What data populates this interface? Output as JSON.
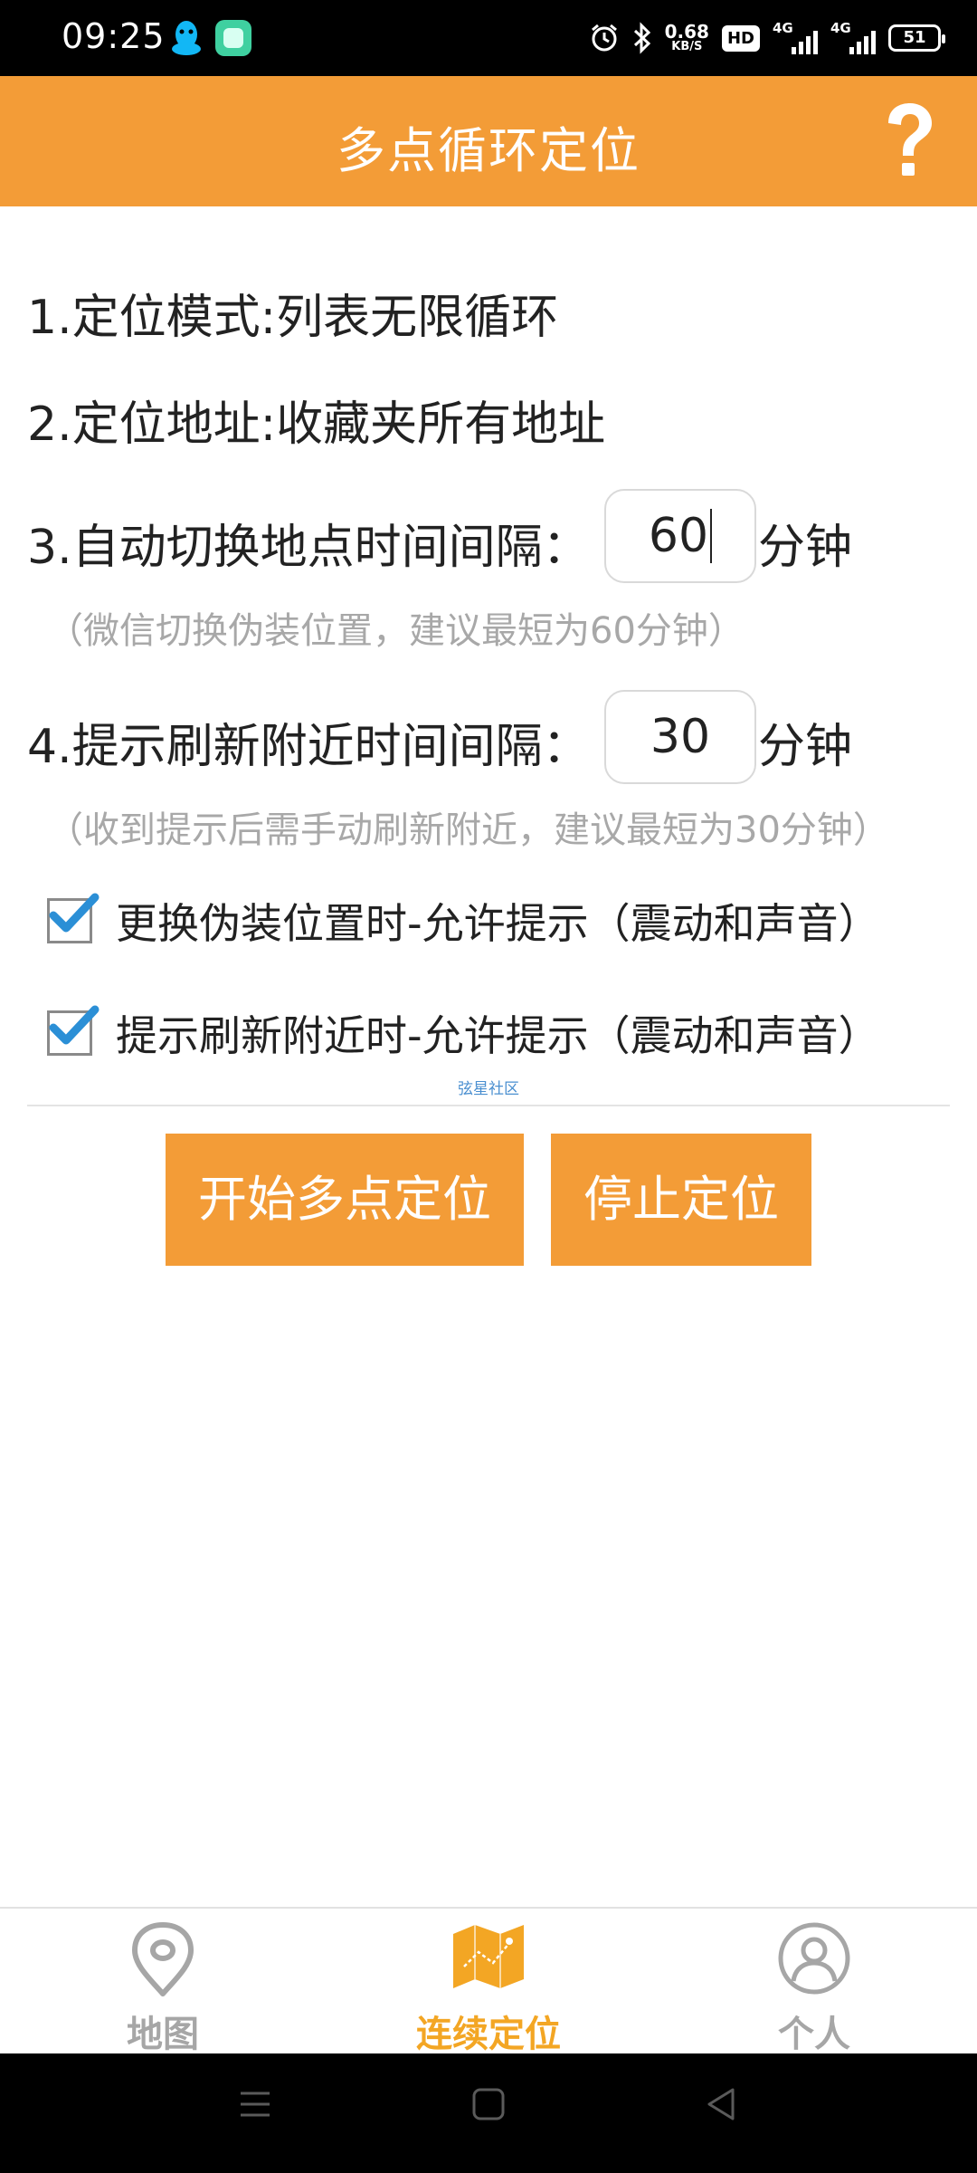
{
  "status_bar": {
    "time": "09:25",
    "net_speed_value": "0.68",
    "net_speed_unit": "KB/S",
    "hd_label": "HD",
    "sim1_label": "4G",
    "sim2_label": "4G",
    "battery": "51"
  },
  "header": {
    "title": "多点循环定位",
    "help_icon": "question-mark-icon"
  },
  "settings": {
    "mode_line": "1.定位模式:列表无限循环",
    "address_line": "2.定位地址:收藏夹所有地址",
    "switch_interval_label": "3.自动切换地点时间间隔：",
    "switch_interval_value": "60",
    "switch_interval_unit": "分钟",
    "switch_interval_hint": "（微信切换伪装位置，建议最短为60分钟）",
    "refresh_interval_label": "4.提示刷新附近时间间隔：",
    "refresh_interval_value": "30",
    "refresh_interval_unit": "分钟",
    "refresh_interval_hint": "（收到提示后需手动刷新附近，建议最短为30分钟）"
  },
  "checkboxes": [
    {
      "label": "更换伪装位置时-允许提示（震动和声音）",
      "checked": true
    },
    {
      "label": "提示刷新附近时-允许提示（震动和声音）",
      "checked": true
    }
  ],
  "watermark": "弦星社区",
  "buttons": {
    "start": "开始多点定位",
    "stop": "停止定位"
  },
  "tabs": [
    {
      "label": "地图",
      "icon": "map-pin-icon",
      "active": false
    },
    {
      "label": "连续定位",
      "icon": "folded-map-icon",
      "active": true
    },
    {
      "label": "个人",
      "icon": "user-icon",
      "active": false
    }
  ],
  "colors": {
    "accent": "#f39c37",
    "tab_active": "#f3a624",
    "tab_inactive": "#a6a6a6",
    "hint_text": "#a8a8a8",
    "checkbox_check": "#2b8fd6"
  }
}
